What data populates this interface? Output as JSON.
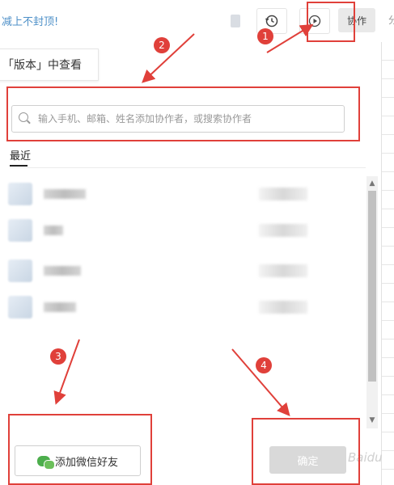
{
  "header": {
    "banner": "减上不封顶!",
    "collab_label": "协作",
    "share_cut": "分"
  },
  "tooltip": {
    "text": "「版本」中查看"
  },
  "search": {
    "placeholder": "输入手机、邮箱、姓名添加协作者，或搜索协作者"
  },
  "recent": {
    "title": "最近",
    "rows": [
      {
        "name": "██████"
      },
      {
        "name": "███"
      },
      {
        "name": "█████"
      },
      {
        "name": "████"
      }
    ]
  },
  "footer": {
    "wechat_label": "添加微信好友",
    "confirm_label": "确定",
    "watermark": "Baidu"
  },
  "annotations": {
    "badge1": "1",
    "badge2": "2",
    "badge3": "3",
    "badge4": "4"
  },
  "colors": {
    "annotation": "#e0403a",
    "banner": "#4e90c8",
    "wechat": "#4cae4c"
  }
}
